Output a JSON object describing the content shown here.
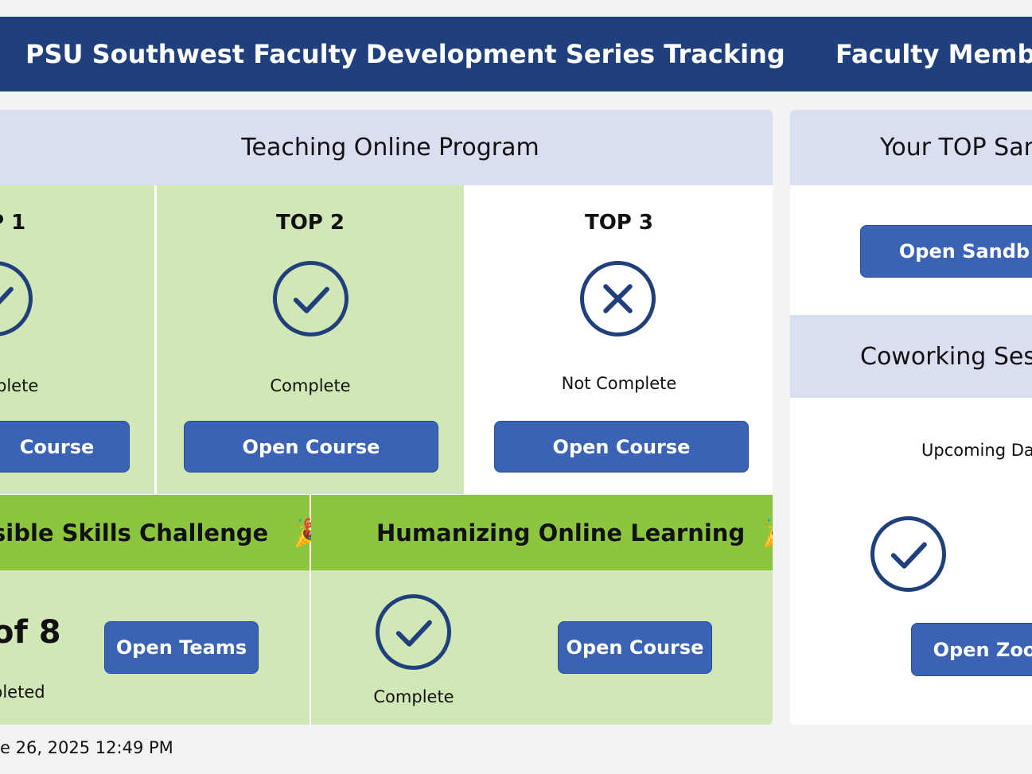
{
  "header": {
    "title": "PSU Southwest Faculty Development Series Tracking",
    "right_title": "Faculty Membe"
  },
  "top_program": {
    "title": "Teaching Online Program",
    "items": [
      {
        "label": "P 1",
        "status": "plete",
        "button": "Course",
        "complete": true
      },
      {
        "label": "TOP 2",
        "status": "Complete",
        "button": "Open Course",
        "complete": true
      },
      {
        "label": "TOP 3",
        "status": "Not Complete",
        "button": "Open Course",
        "complete": false
      }
    ]
  },
  "accessible": {
    "title": "sible Skills Challenge",
    "count": "of 8",
    "status": "bleted",
    "button": "Open Teams"
  },
  "humanizing": {
    "title": "Humanizing Online Learning",
    "status": "Complete",
    "button": "Open Course"
  },
  "sandbox": {
    "title": "Your TOP San",
    "button": "Open Sandb"
  },
  "coworking": {
    "title": "Coworking Sess",
    "upcoming": "Upcoming Da",
    "button": "Open Zoon"
  },
  "footer": {
    "timestamp": "e 26, 2025 12:49 PM"
  },
  "icons": {
    "party": "🎉"
  },
  "colors": {
    "header": "#1f3f7d",
    "button": "#3a62b5",
    "complete_bg": "#d1e7b5",
    "banner_green": "#8cc63f",
    "section_head": "#d9dff0"
  }
}
